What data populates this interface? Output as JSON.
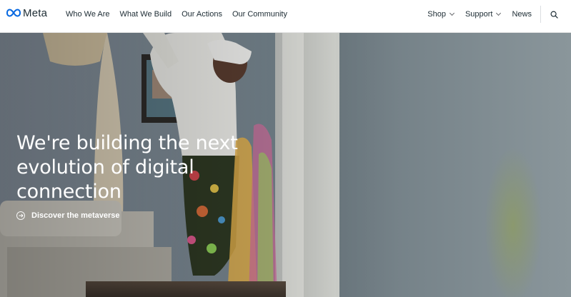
{
  "brand": {
    "logo_icon": "meta-infinity-logo",
    "name": "Meta",
    "color": "#0668E1"
  },
  "nav": {
    "primary": [
      {
        "label": "Who We Are"
      },
      {
        "label": "What We Build"
      },
      {
        "label": "Our Actions"
      },
      {
        "label": "Our Community"
      }
    ],
    "secondary": {
      "shop": {
        "label": "Shop",
        "icon": "chevron-down-icon"
      },
      "support": {
        "label": "Support",
        "icon": "chevron-down-icon"
      },
      "news": {
        "label": "News"
      },
      "search_icon": "search-icon"
    }
  },
  "hero": {
    "headline": "We're building the next evolution of digital connection",
    "cta": {
      "label": "Discover the metaverse",
      "icon": "arrow-right-circle-icon"
    },
    "background": "video-still-person-wearing-vr-headset-in-room-with-surfboards",
    "colors": {
      "text": "#FFFFFF",
      "wall": "#7F8A8F"
    }
  }
}
